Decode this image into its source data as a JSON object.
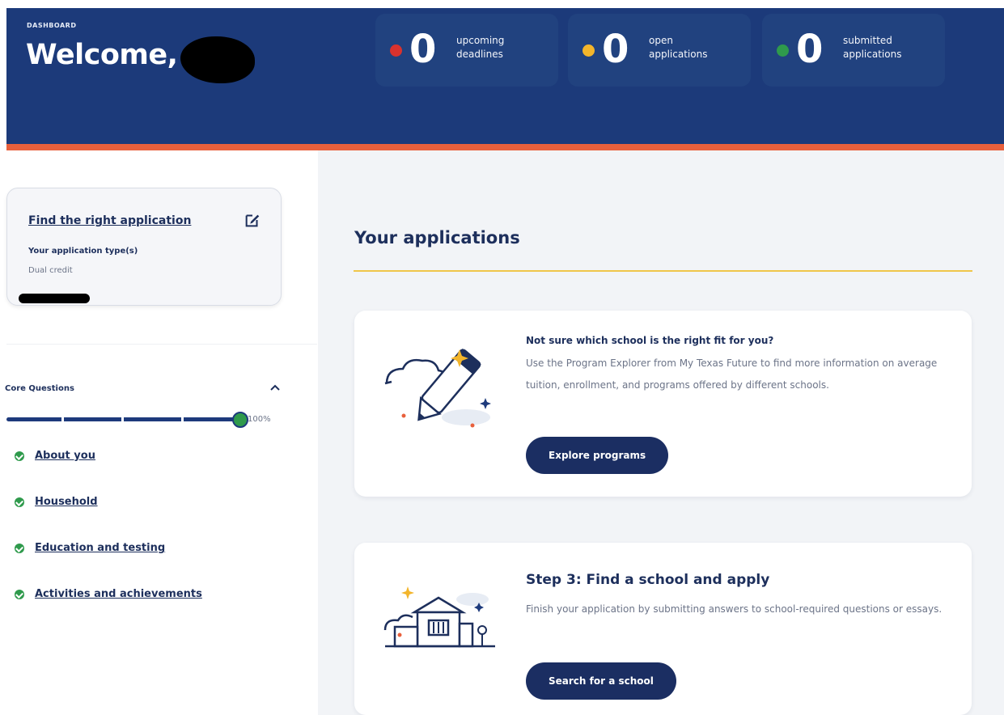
{
  "header": {
    "eyebrow": "DASHBOARD",
    "welcome": "Welcome,",
    "stats": [
      {
        "value": "0",
        "line1": "upcoming",
        "line2": "deadlines",
        "dot_color": "#d9322e"
      },
      {
        "value": "0",
        "line1": "open",
        "line2": "applications",
        "dot_color": "#f3b52b"
      },
      {
        "value": "0",
        "line1": "submitted",
        "line2": "applications",
        "dot_color": "#2f9a4c"
      }
    ]
  },
  "sidebar": {
    "finder": {
      "link": "Find the right application",
      "type_label": "Your application type(s)",
      "type_value": "Dual credit"
    },
    "core": {
      "title": "Core Questions",
      "progress_pct": "100%",
      "progress_value": 1.0
    },
    "items": [
      {
        "label": "About you"
      },
      {
        "label": "Household"
      },
      {
        "label": "Education and testing"
      },
      {
        "label": "Activities and achievements"
      }
    ]
  },
  "main": {
    "title": "Your applications",
    "cards": [
      {
        "heading": "Not sure which school is the right fit for you?",
        "body": "Use the Program Explorer from My Texas Future to find more information on average tuition, enrollment, and programs offered by different schools.",
        "button": "Explore programs"
      },
      {
        "heading": "Step 3: Find a school and apply",
        "body": "Finish your application by submitting answers to school-required questions or essays.",
        "button": "Search for a school"
      }
    ]
  },
  "colors": {
    "navy": "#1c3a7a",
    "accent_orange": "#e8603c",
    "accent_gold": "#f0c64a",
    "success": "#2f9a4c",
    "button": "#1b2e62"
  }
}
